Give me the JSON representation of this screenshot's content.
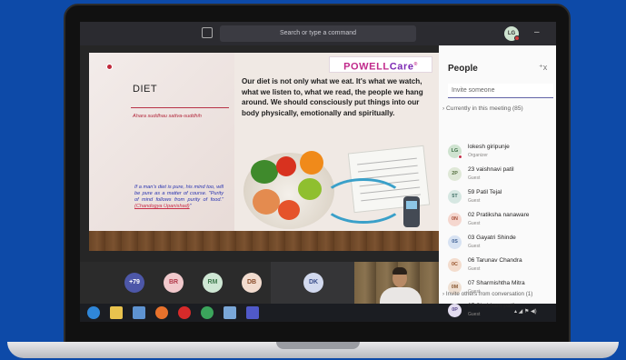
{
  "app": {
    "search_placeholder": "Search or type a command",
    "me_initials": "LG"
  },
  "slide": {
    "title": "DIET",
    "sanskrit": "Ahara suddhau sattva-suddhih",
    "brand_main": "POWELL",
    "brand_accent": "Care",
    "brand_mark": "®",
    "body": "Our diet is not only what we eat. It's what we watch, what we listen to, what we read, the people we hang around. We should consciously put things into our body physically, emotionally and spiritually.",
    "quote": "If a man's diet is pure, his mind too, will be pure as a matter of course. \"Purity of mind follows from purity of food.\" ",
    "quote_source": "(Chandogya Upanishad)",
    "quote_end": "\""
  },
  "participants_strip": [
    {
      "label": "+79",
      "bg": "#4d57a8",
      "fg": "#ffffff"
    },
    {
      "label": "BR",
      "bg": "#f1c9cc",
      "fg": "#b13a4a"
    },
    {
      "label": "RM",
      "bg": "#cfe7d4",
      "fg": "#3f7a4d"
    },
    {
      "label": "DB",
      "bg": "#f2dccf",
      "fg": "#8a4c2a"
    },
    {
      "label": "DK",
      "bg": "#d2d9ee",
      "fg": "#3a4e8a"
    }
  ],
  "people_panel": {
    "title": "People",
    "invite_placeholder": "Invite someone",
    "current_label": "Currently in this meeting (85)",
    "invite_others": "Invite others from conversation (1)",
    "members": [
      {
        "initials": "LG",
        "name": "lokesh giripunje",
        "role": "Organizer",
        "bg": "#cfe3d0",
        "fg": "#3b6d45"
      },
      {
        "initials": "2P",
        "name": "23 vaishnavi patil",
        "role": "Guest",
        "bg": "#dfe8d7",
        "fg": "#55703f"
      },
      {
        "initials": "5T",
        "name": "59 Patil Tejal",
        "role": "Guest",
        "bg": "#d6e7e2",
        "fg": "#3e6f64"
      },
      {
        "initials": "0N",
        "name": "02 Pratiksha nanaware",
        "role": "Guest",
        "bg": "#f5d7cf",
        "fg": "#a44a34"
      },
      {
        "initials": "0S",
        "name": "03 Gayatri Shinde",
        "role": "Guest",
        "bg": "#d7e2f2",
        "fg": "#3d5e93"
      },
      {
        "initials": "0C",
        "name": "06 Tarunav Chandra",
        "role": "Guest",
        "bg": "#f3dccd",
        "fg": "#96532b"
      },
      {
        "initials": "0M",
        "name": "07 Sharmishtha Mitra",
        "role": "Guest",
        "bg": "#efe0d3",
        "fg": "#8a5a34"
      },
      {
        "initials": "0P",
        "name": "07 Shubham patil",
        "role": "Guest",
        "bg": "#e2dcef",
        "fg": "#5a4a8e"
      }
    ]
  },
  "taskbar": {
    "icons": [
      "ie-icon",
      "file-explorer-icon",
      "media-player-icon",
      "firefox-icon",
      "opera-icon",
      "chrome-icon",
      "app-icon",
      "teams-icon"
    ],
    "colors": [
      "#2f86d8",
      "#e9c34e",
      "#5e93d1",
      "#e8722c",
      "#d82a2a",
      "#3ba55c",
      "#7aa7d8",
      "#5059c9"
    ]
  }
}
